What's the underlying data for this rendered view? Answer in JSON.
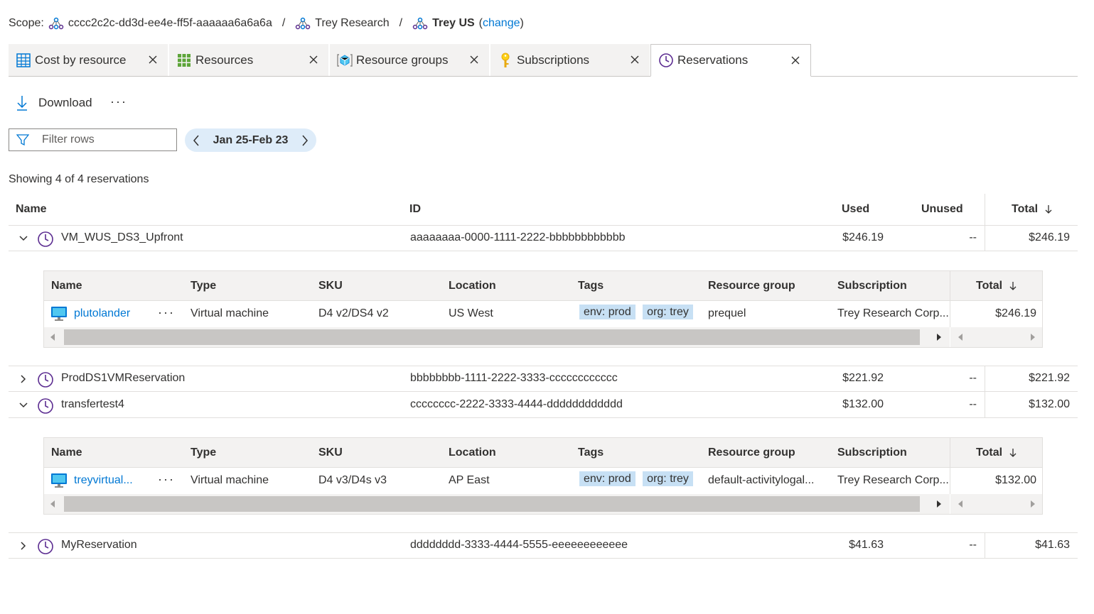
{
  "scope": {
    "label": "Scope:",
    "mg_id": "cccc2c2c-dd3d-ee4e-ff5f-aaaaaa6a6a6a",
    "parent": "Trey Research",
    "current": "Trey US",
    "change_open": "(",
    "change_label": "change",
    "change_close": ")"
  },
  "tabs": [
    {
      "label": "Cost by resource",
      "icon": "grid-icon"
    },
    {
      "label": "Resources",
      "icon": "resources-icon"
    },
    {
      "label": "Resource groups",
      "icon": "resource-group-icon"
    },
    {
      "label": "Subscriptions",
      "icon": "key-icon"
    },
    {
      "label": "Reservations",
      "icon": "clock-icon",
      "active": true
    }
  ],
  "toolbar": {
    "download_label": "Download",
    "more_label": "···"
  },
  "filter": {
    "placeholder": "Filter rows"
  },
  "date_range": {
    "label": "Jan 25-Feb 23"
  },
  "summary": {
    "showing": "Showing 4 of 4 reservations"
  },
  "table": {
    "headers": {
      "name": "Name",
      "id": "ID",
      "used": "Used",
      "unused": "Unused",
      "total": "Total"
    },
    "rows": [
      {
        "name": "VM_WUS_DS3_Upfront",
        "id": "aaaaaaaa-0000-1111-2222-bbbbbbbbbbbb",
        "used": "$246.19",
        "unused": "--",
        "total": "$246.19",
        "expanded": true
      },
      {
        "name": "ProdDS1VMReservation",
        "id": "bbbbbbbb-1111-2222-3333-cccccccccccc",
        "used": "$221.92",
        "unused": "--",
        "total": "$221.92",
        "expanded": false
      },
      {
        "name": "transfertest4",
        "id": "cccccccc-2222-3333-4444-dddddddddddd",
        "used": "$132.00",
        "unused": "--",
        "total": "$132.00",
        "expanded": true
      },
      {
        "name": "MyReservation",
        "id": "dddddddd-3333-4444-5555-eeeeeeeeeeee",
        "used": "$41.63",
        "unused": "--",
        "total": "$41.63",
        "expanded": false
      }
    ]
  },
  "nested": {
    "headers": {
      "name": "Name",
      "type": "Type",
      "sku": "SKU",
      "location": "Location",
      "tags": "Tags",
      "rg": "Resource group",
      "sub": "Subscription",
      "total": "Total"
    },
    "rows": [
      {
        "name": "plutolander",
        "more": "···",
        "type": "Virtual machine",
        "sku": "D4 v2/DS4 v2",
        "location": "US West",
        "tag1": "env: prod",
        "tag2": "org: trey",
        "rg": "prequel",
        "sub": "Trey Research Corp...",
        "total": "$246.19"
      },
      {
        "name": "treyvirtual...",
        "more": "···",
        "type": "Virtual machine",
        "sku": "D4 v3/D4s v3",
        "location": "AP East",
        "tag1": "env: prod",
        "tag2": "org: trey",
        "rg": "default-activitylogal...",
        "sub": "Trey Research Corp...",
        "total": "$132.00"
      }
    ]
  },
  "colors": {
    "accent": "#0078d4",
    "tag_bg": "#c7e0f4",
    "pill_bg": "#deecf9",
    "clock": "#5c2d91"
  }
}
